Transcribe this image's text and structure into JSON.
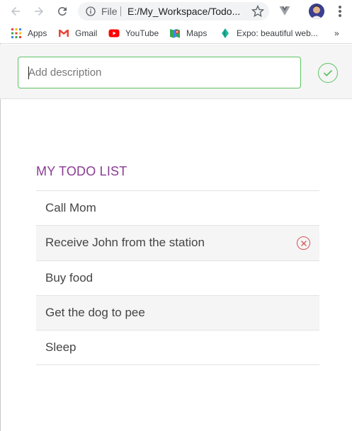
{
  "browser": {
    "url_scheme_label": "File",
    "url_text": "E:/My_Workspace/Todo...",
    "back_icon": "arrow-left-icon",
    "forward_icon": "arrow-right-icon",
    "reload_icon": "reload-icon",
    "star_icon": "star-icon",
    "menu_icon": "more-vert-icon"
  },
  "bookmarks": {
    "items": [
      {
        "label": "Apps",
        "icon": "apps-grid-icon"
      },
      {
        "label": "Gmail",
        "icon": "gmail-icon"
      },
      {
        "label": "YouTube",
        "icon": "youtube-icon"
      },
      {
        "label": "Maps",
        "icon": "maps-icon"
      },
      {
        "label": "Expo: beautiful web...",
        "icon": "expo-icon"
      }
    ],
    "overflow": "»"
  },
  "app": {
    "input_placeholder": "Add description",
    "input_value": "",
    "confirm_icon": "check-icon",
    "list_title": "MY TODO LIST",
    "accent_color": "#8a3c94",
    "confirm_color": "#5dc264",
    "remove_color": "#d9534f",
    "todos": [
      {
        "text": "Call Mom"
      },
      {
        "text": "Receive John from the station",
        "hover_remove": true
      },
      {
        "text": "Buy food"
      },
      {
        "text": "Get the dog to pee"
      },
      {
        "text": "Sleep"
      }
    ]
  }
}
